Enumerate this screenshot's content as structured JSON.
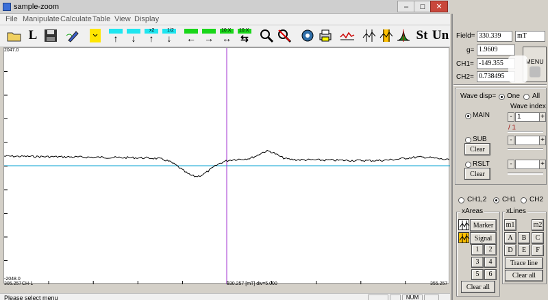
{
  "window": {
    "title": "sample-zoom",
    "minimize": "–",
    "maximize": "□",
    "close": "✕"
  },
  "menu": [
    "File",
    "Manipulate",
    "Calculate",
    "Table",
    "View",
    "Display"
  ],
  "toolbar": {
    "l_label": "L",
    "x2_label": "x2",
    "half_label": "1/2",
    "ten_label_1": "10.X",
    "ten_label_2": "10.X",
    "st_label": "St",
    "un_label": "Un"
  },
  "plot": {
    "ymax_label": "2047.0",
    "ymin_label": "-2048.0",
    "x_left_label": "305.257",
    "channel_label": "CH-1",
    "x_center_label": "330.257 [mT]  div=5.000",
    "x_right_label": "355.257",
    "colors": {
      "trace": "#000000",
      "baseline": "#00a0d0",
      "cursor": "#a030d0"
    }
  },
  "status": {
    "text": "Please select menu",
    "num": "NUM"
  },
  "panel": {
    "field_label": "Field=",
    "field_value": "330.339",
    "field_unit": "mT",
    "g_label": "g=",
    "g_value": "1.9609",
    "ch1_label": "CH1=",
    "ch1_value": "-149.355",
    "ch2_label": "CH2=",
    "ch2_value": "0.738495",
    "menu_button": "MENU",
    "wave_disp_label": "Wave disp=",
    "wave_one": "One",
    "wave_all": "All",
    "wave_index_label": "Wave index",
    "main_label": "MAIN",
    "wave_index_value": "1",
    "wave_index_total": "/ 1",
    "sub_label": "SUB",
    "rslt_label": "RSLT",
    "clear_label": "Clear",
    "spin_minus": "-",
    "spin_plus": "+",
    "ch12_label": "CH1,2",
    "ch1_radio": "CH1",
    "ch2_radio": "CH2",
    "xareas_label": "xAreas",
    "xlines_label": "xLines",
    "marker_btn": "Marker",
    "signal_btn": "Signal",
    "n1": "1",
    "n2": "2",
    "n3": "3",
    "n4": "4",
    "n5": "5",
    "n6": "6",
    "clear_all": "Clear all",
    "m1": "m1",
    "m2": "m2",
    "a": "A",
    "b": "B",
    "c": "C",
    "d": "D",
    "e": "E",
    "f": "F",
    "trace_line": "Trace line"
  }
}
